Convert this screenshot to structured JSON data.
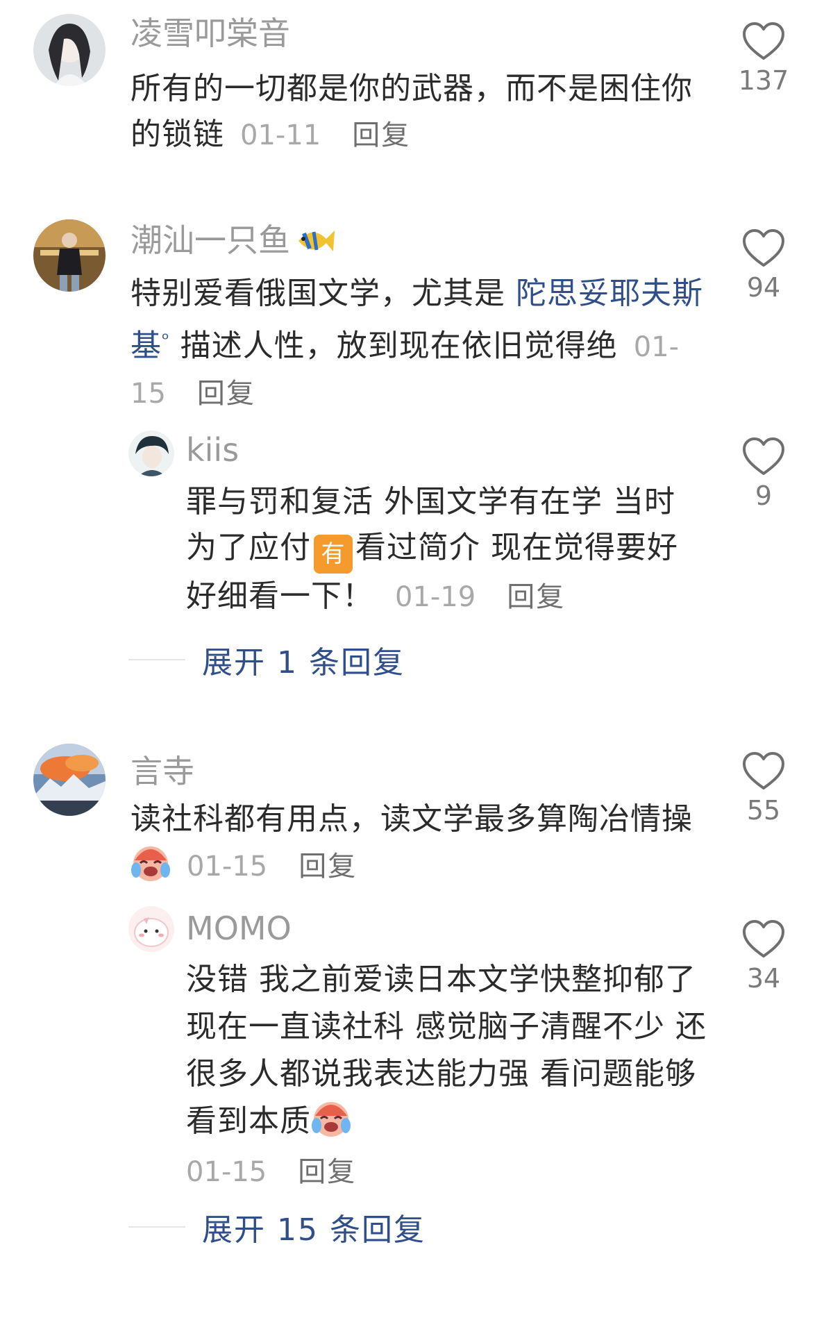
{
  "comments": [
    {
      "username": "凌雪叩棠音",
      "text": "所有的一切都是你的武器，而不是困住你的锁链",
      "date": "01-11",
      "reply_label": "回复",
      "likes": "137",
      "avatar_icon": "portrait-girl-avatar"
    },
    {
      "username": "潮汕一只鱼",
      "text_before": "特别爱看俄国文学，尤其是 ",
      "link_text": "陀思妥耶夫斯基",
      "text_after": " 描述人性，放到现在依旧觉得绝",
      "date": "01-15",
      "reply_label": "回复",
      "likes": "94",
      "avatar_icon": "person-photo-avatar",
      "name_emoji": "tropical-fish-icon",
      "replies": [
        {
          "username": "kiis",
          "text_before": "罪与罚和复活 外国文学有在学 当时为了应付",
          "tag": "有",
          "text_after": "看过简介 现在觉得要好好细看一下！",
          "date": "01-19",
          "reply_label": "回复",
          "likes": "9",
          "avatar_icon": "anime-boy-avatar"
        }
      ],
      "expand_label": "展开 1 条回复"
    },
    {
      "username": "言寺",
      "text": "读社科都有用点，读文学最多算陶冶情操",
      "date": "01-15",
      "reply_label": "回复",
      "likes": "55",
      "avatar_icon": "sunset-mountain-avatar",
      "emoji": "crying-laughing-icon",
      "replies": [
        {
          "username": "MOMO",
          "text": "没错 我之前爱读日本文学快整抑郁了 现在一直读社科 感觉脑子清醒不少 还很多人都说我表达能力强 看问题能够看到本质",
          "date": "01-15",
          "reply_label": "回复",
          "likes": "34",
          "avatar_icon": "pink-character-avatar",
          "emoji": "crying-laughing-icon"
        }
      ],
      "expand_label": "展开 15 条回复"
    }
  ],
  "colors": {
    "username": "#9a9a9a",
    "text": "#2b2b2b",
    "link": "#2f4f8a",
    "meta": "#a8a8a8"
  }
}
